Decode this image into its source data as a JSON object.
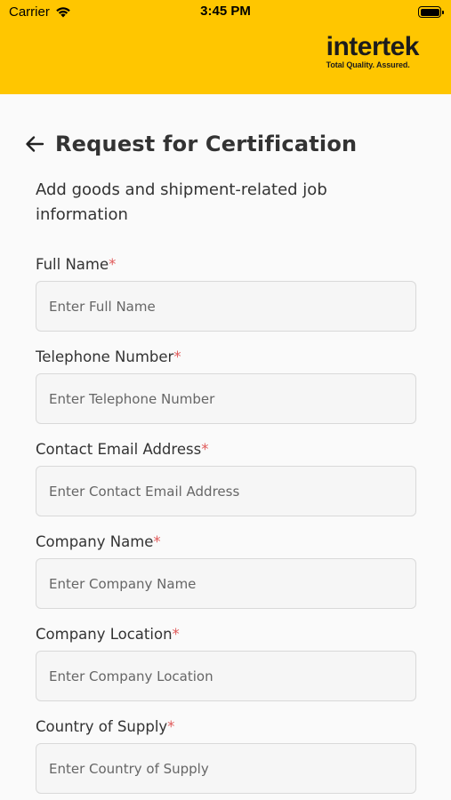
{
  "status_bar": {
    "carrier": "Carrier",
    "time": "3:45 PM"
  },
  "brand": {
    "name": "intertek",
    "tagline": "Total Quality. Assured.",
    "color": "#ffc600"
  },
  "page": {
    "title": "Request for Certification",
    "subtitle": "Add goods and shipment-related job information"
  },
  "fields": [
    {
      "label": "Full Name",
      "required": "*",
      "placeholder": "Enter Full Name",
      "value": ""
    },
    {
      "label": "Telephone Number",
      "required": "*",
      "placeholder": "Enter Telephone Number",
      "value": ""
    },
    {
      "label": "Contact Email Address",
      "required": "*",
      "placeholder": "Enter Contact Email Address",
      "value": ""
    },
    {
      "label": "Company Name",
      "required": "*",
      "placeholder": "Enter Company Name",
      "value": ""
    },
    {
      "label": "Company Location",
      "required": "*",
      "placeholder": "Enter Company Location",
      "value": ""
    },
    {
      "label": "Country of Supply",
      "required": "*",
      "placeholder": "Enter Country of Supply",
      "value": ""
    }
  ]
}
